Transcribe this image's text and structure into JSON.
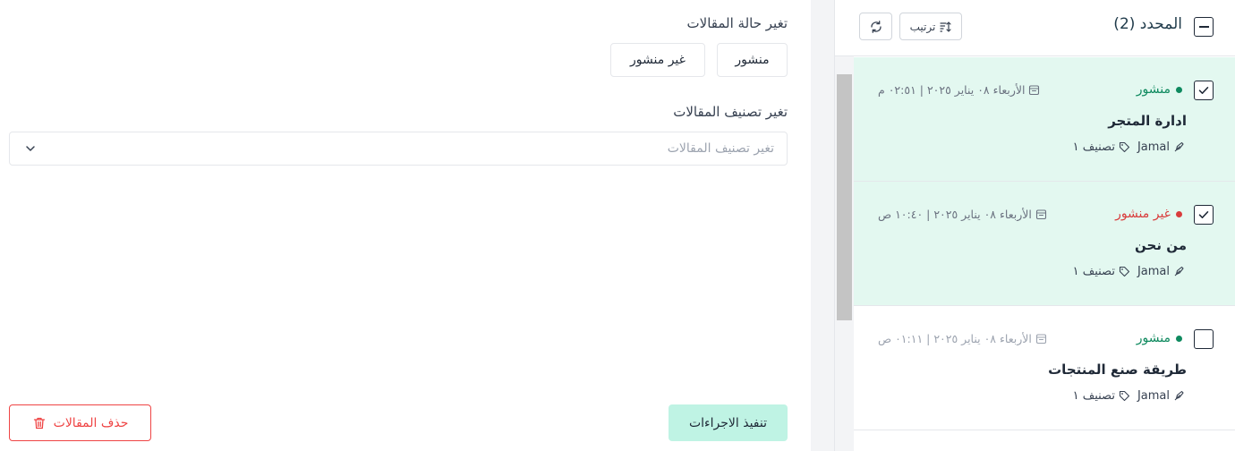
{
  "form": {
    "status_label": "تغير حالة المقالات",
    "status_options": [
      "منشور",
      "غير منشور"
    ],
    "category_label": "تغير تصنيف المقالات",
    "category_placeholder": "تغير تصنيف المقالات",
    "execute_label": "تنفيذ الاجراءات",
    "delete_label": "حذف المقالات"
  },
  "list_header": {
    "selected_title": "المحدد (2)",
    "sort_label": "ترتيب"
  },
  "articles": [
    {
      "status": "منشور",
      "status_color": "#0f8a5f",
      "date": "الأربعاء ٠٨ يناير ٢٠٢٥ | ٠٢:٥١ م",
      "title": "ادارة المتجر",
      "author": "Jamal",
      "category": "تصنيف ١",
      "selected": true
    },
    {
      "status": "غير منشور",
      "status_color": "#d93c3c",
      "date": "الأربعاء ٠٨ يناير ٢٠٢٥ | ١٠:٤٠ ص",
      "title": "من نحن",
      "author": "Jamal",
      "category": "تصنيف ١",
      "selected": true
    },
    {
      "status": "منشور",
      "status_color": "#0f8a5f",
      "date": "الأربعاء ٠٨ يناير ٢٠٢٥ | ٠١:١١ ص",
      "title": "طريقة صنع المنتجات",
      "author": "Jamal",
      "category": "تصنيف ١",
      "selected": false
    }
  ],
  "colors": {
    "selected_row_bg": "#e3f8f0",
    "execute_btn_bg": "#bff3e4",
    "delete_red": "#ef4444",
    "published_green": "#0f8a5f",
    "unpublished_red": "#d93c3c"
  }
}
